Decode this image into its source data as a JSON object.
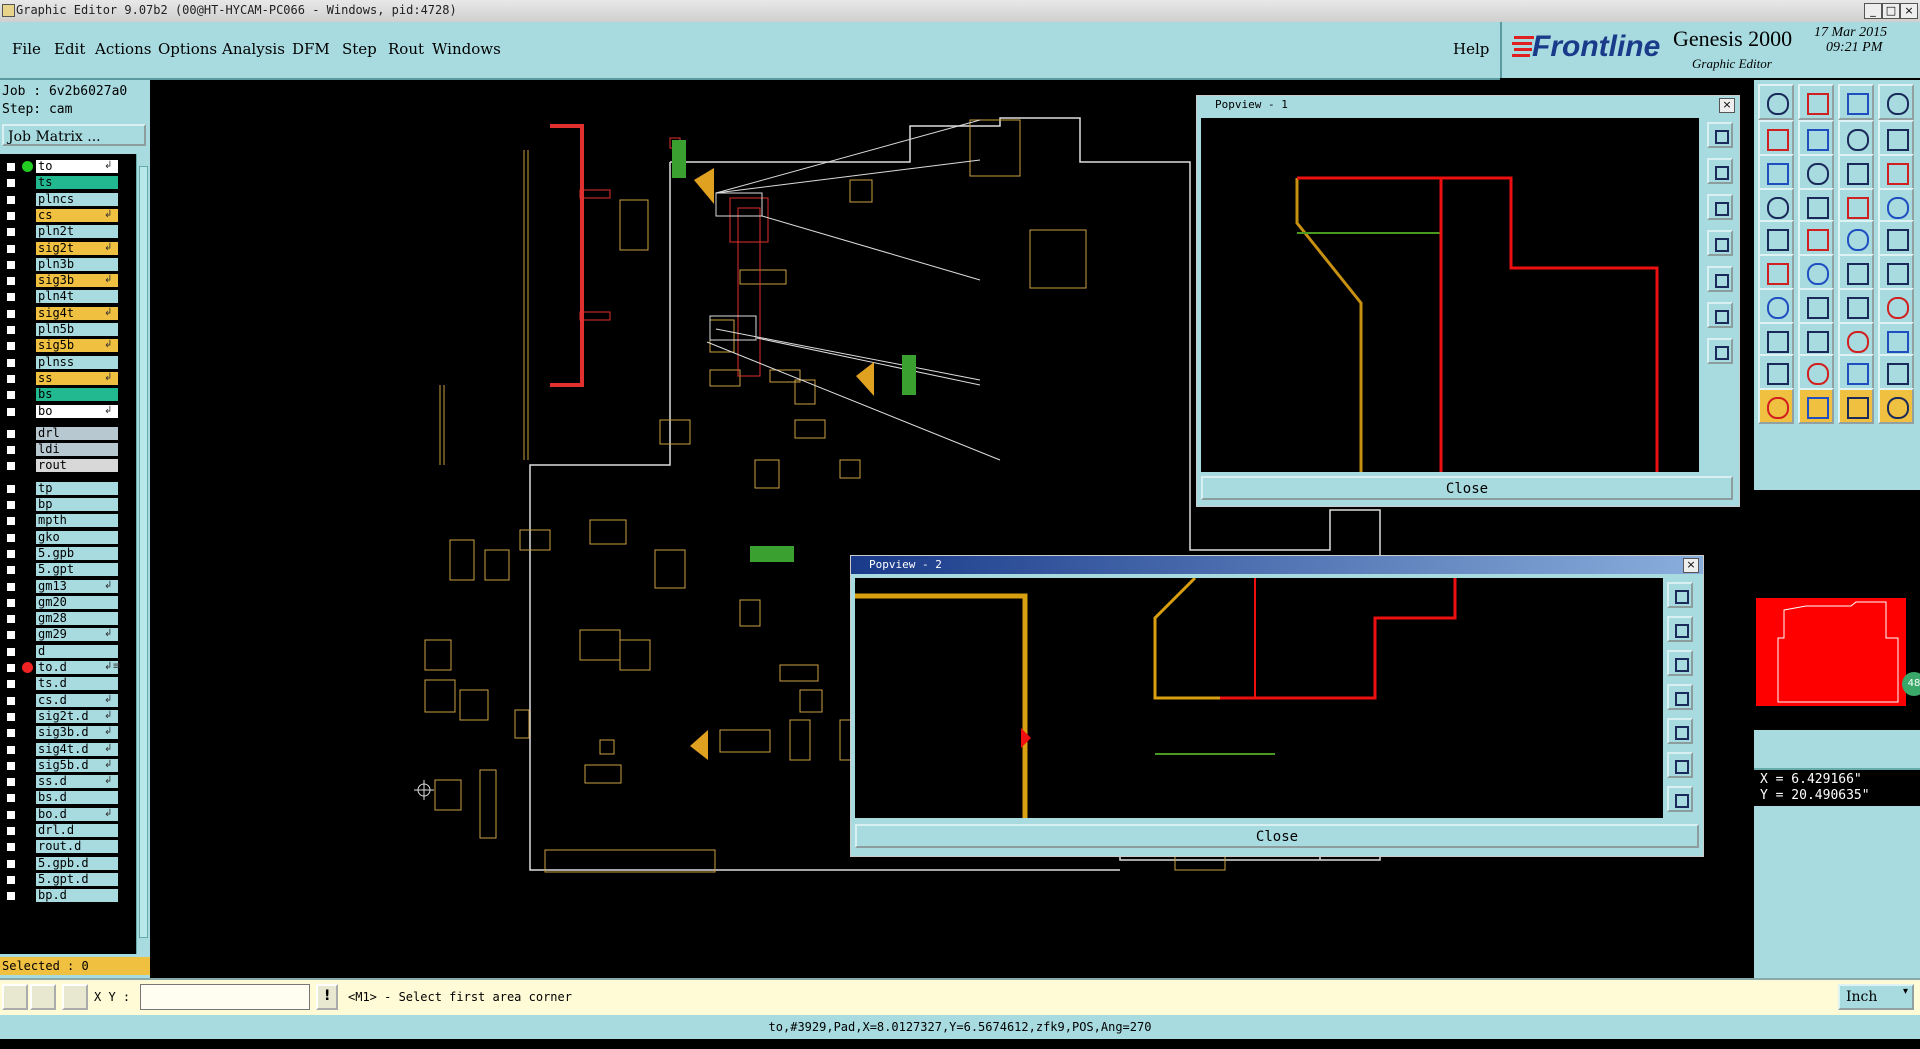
{
  "window": {
    "title": "Graphic Editor 9.07b2 (00@HT-HYCAM-PC066 - Windows, pid:4728)",
    "controls": [
      "_",
      "□",
      "×"
    ]
  },
  "menubar": {
    "items": [
      "File",
      "Edit",
      "Actions",
      "Options",
      "Analysis",
      "DFM",
      "Step",
      "Rout",
      "Windows"
    ],
    "help": "Help"
  },
  "logo": {
    "brand": "Frontline",
    "product": "Genesis 2000",
    "subtitle": "Graphic Editor",
    "date": "17 Mar 2015",
    "time": "09:21 PM"
  },
  "job": {
    "job_line": "Job : 6v2b6027a0",
    "step_line": "Step: cam",
    "matrix_button": "Job Matrix ..."
  },
  "layers": [
    {
      "name": "to",
      "color": "#ffffff",
      "mark": "↲",
      "dot": "#22cc22"
    },
    {
      "name": "ts",
      "color": "#22b890",
      "mark": ""
    },
    {
      "name": "plncs",
      "color": "#a8dbe0",
      "mark": ""
    },
    {
      "name": "cs",
      "color": "#f0c040",
      "mark": "↲"
    },
    {
      "name": "pln2t",
      "color": "#a8dbe0",
      "mark": ""
    },
    {
      "name": "sig2t",
      "color": "#f0c040",
      "mark": "↲"
    },
    {
      "name": "pln3b",
      "color": "#a8dbe0",
      "mark": ""
    },
    {
      "name": "sig3b",
      "color": "#f0c040",
      "mark": "↲"
    },
    {
      "name": "pln4t",
      "color": "#a8dbe0",
      "mark": ""
    },
    {
      "name": "sig4t",
      "color": "#f0c040",
      "mark": "↲"
    },
    {
      "name": "pln5b",
      "color": "#a8dbe0",
      "mark": ""
    },
    {
      "name": "sig5b",
      "color": "#f0c040",
      "mark": "↲"
    },
    {
      "name": "plnss",
      "color": "#a8dbe0",
      "mark": ""
    },
    {
      "name": "ss",
      "color": "#f0c040",
      "mark": "↲"
    },
    {
      "name": "bs",
      "color": "#22b890",
      "mark": ""
    },
    {
      "name": "bo",
      "color": "#ffffff",
      "mark": "↲"
    },
    {
      "name": "drl",
      "color": "#b8c8d0",
      "mark": ""
    },
    {
      "name": "ldi",
      "color": "#b8c8d0",
      "mark": ""
    },
    {
      "name": "rout",
      "color": "#d8d8d8",
      "mark": ""
    },
    {
      "name": "tp",
      "color": "#a8dbe0",
      "mark": ""
    },
    {
      "name": "bp",
      "color": "#a8dbe0",
      "mark": ""
    },
    {
      "name": "mpth",
      "color": "#a8dbe0",
      "mark": ""
    },
    {
      "name": "gko",
      "color": "#a8dbe0",
      "mark": ""
    },
    {
      "name": "5.gpb",
      "color": "#a8dbe0",
      "mark": ""
    },
    {
      "name": "5.gpt",
      "color": "#a8dbe0",
      "mark": ""
    },
    {
      "name": "gm13",
      "color": "#a8dbe0",
      "mark": "↲"
    },
    {
      "name": "gm20",
      "color": "#a8dbe0",
      "mark": ""
    },
    {
      "name": "gm28",
      "color": "#a8dbe0",
      "mark": ""
    },
    {
      "name": "gm29",
      "color": "#a8dbe0",
      "mark": "↲"
    },
    {
      "name": "d",
      "color": "#a8dbe0",
      "mark": ""
    },
    {
      "name": "to.d",
      "color": "#a8dbe0",
      "mark": "↲≡",
      "dot": "#ee2222"
    },
    {
      "name": "ts.d",
      "color": "#a8dbe0",
      "mark": ""
    },
    {
      "name": "cs.d",
      "color": "#a8dbe0",
      "mark": "↲"
    },
    {
      "name": "sig2t.d",
      "color": "#a8dbe0",
      "mark": "↲"
    },
    {
      "name": "sig3b.d",
      "color": "#a8dbe0",
      "mark": "↲"
    },
    {
      "name": "sig4t.d",
      "color": "#a8dbe0",
      "mark": "↲"
    },
    {
      "name": "sig5b.d",
      "color": "#a8dbe0",
      "mark": "↲"
    },
    {
      "name": "ss.d",
      "color": "#a8dbe0",
      "mark": "↲"
    },
    {
      "name": "bs.d",
      "color": "#a8dbe0",
      "mark": ""
    },
    {
      "name": "bo.d",
      "color": "#a8dbe0",
      "mark": "↲"
    },
    {
      "name": "drl.d",
      "color": "#a8dbe0",
      "mark": ""
    },
    {
      "name": "rout.d",
      "color": "#a8dbe0",
      "mark": ""
    },
    {
      "name": "5.gpb.d",
      "color": "#a8dbe0",
      "mark": ""
    },
    {
      "name": "5.gpt.d",
      "color": "#a8dbe0",
      "mark": ""
    },
    {
      "name": "bp.d",
      "color": "#a8dbe0",
      "mark": ""
    }
  ],
  "selected_label": "Selected : 0",
  "popview1": {
    "title": "Popview - 1",
    "close_label": "Close"
  },
  "popview2": {
    "title": "Popview - 2",
    "close_label": "Close"
  },
  "coords": {
    "x": "X =  6.429166\"",
    "y": "Y = 20.490635\""
  },
  "command": {
    "xy_label": "X Y :",
    "xy_value": "",
    "prompt": "<M1> - Select first area corner",
    "units": "Inch"
  },
  "status_line": "to,#3929,Pad,X=8.0127327,Y=6.5674612,zfk9,POS,Ang=270",
  "colors": {
    "panel": "#a8dbe0",
    "yellow": "#f0c040",
    "red": "#ff0000",
    "green": "#22b890"
  },
  "icons": {
    "minimap_badge": "48"
  }
}
